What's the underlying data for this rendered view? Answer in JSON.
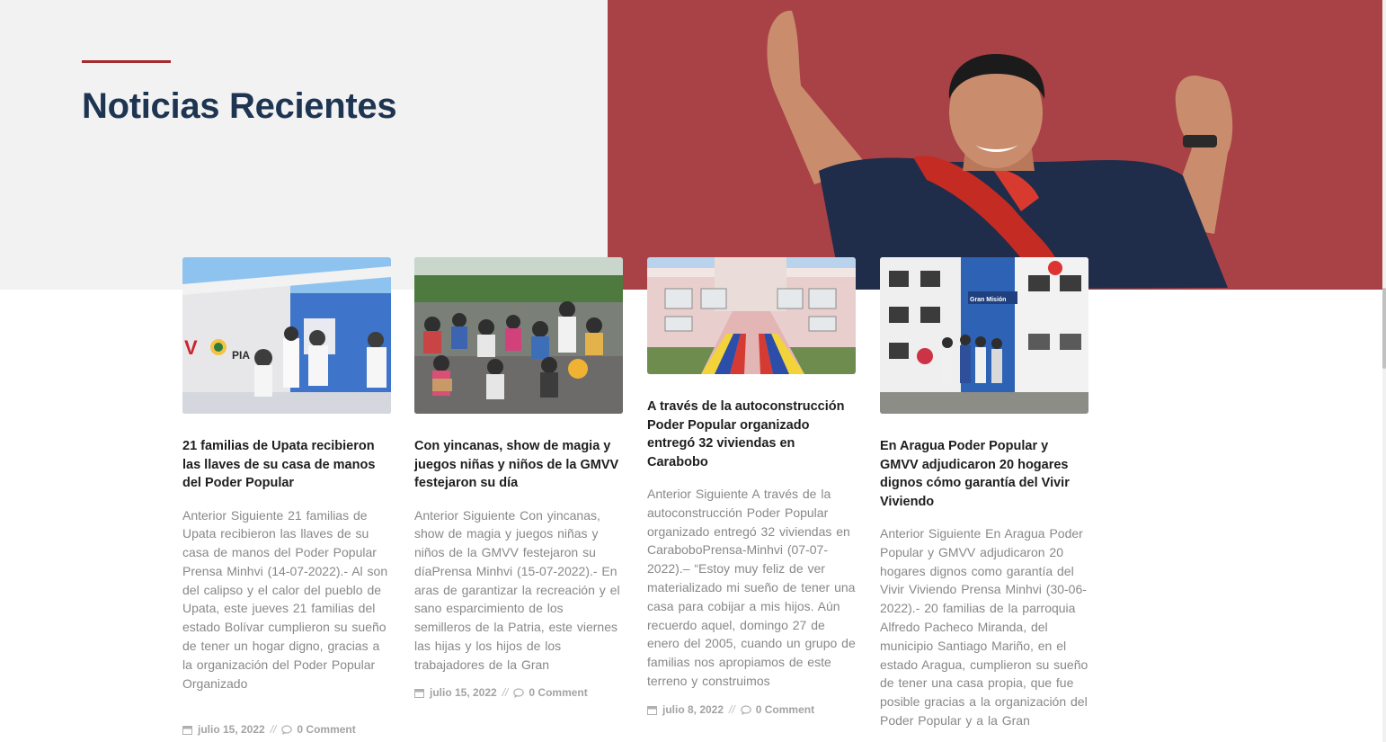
{
  "section": {
    "title": "Noticias Recientes"
  },
  "posts": [
    {
      "title": "21 familias de Upata recibieron las llaves de su casa de manos del Poder Popular",
      "excerpt": "Anterior Siguiente 21 familias de Upata recibieron las llaves de su casa de manos del Poder Popular Prensa Minhvi (14-07-2022).- Al son del calipso y el calor del pueblo de Upata, este jueves 21 familias del estado Bolívar cumplieron su sueño de tener un hogar digno, gracias a la organización del Poder Popular Organizado",
      "date": "julio 15, 2022",
      "comments": "0 Comment",
      "thumb_text": "PIA"
    },
    {
      "title": "Con yincanas, show de magia y juegos niñas y niños de la GMVV festejaron su día",
      "excerpt": "Anterior Siguiente Con yincanas, show de magia y juegos niñas y niños de la GMVV festejaron su díaPrensa Minhvi (15-07-2022).- En aras de garantizar la recreación y el sano esparcimiento de los semilleros de la Patria, este viernes las hijas y los hijos de los trabajadores de la Gran",
      "date": "julio 15, 2022",
      "comments": "0 Comment",
      "thumb_text": ""
    },
    {
      "title": "A través de la autoconstrucción Poder Popular organizado entregó 32 viviendas en Carabobo",
      "excerpt": "Anterior Siguiente A través de la autoconstrucción Poder Popular organizado entregó 32 viviendas en CaraboboPrensa-Minhvi (07-07-2022).– “Estoy muy feliz de ver materializado mi sueño de tener una casa para cobijar a mis hijos. Aún recuerdo aquel, domingo 27 de enero del 2005, cuando un grupo de familias nos apropiamos de este terreno y construimos",
      "date": "julio 8, 2022",
      "comments": "0 Comment",
      "thumb_text": ""
    },
    {
      "title": "En Aragua Poder Popular y GMVV adjudicaron 20 hogares dignos cómo garantía del Vivir Viviendo",
      "excerpt": "Anterior Siguiente En Aragua Poder Popular y GMVV adjudicaron 20 hogares dignos como garantía del Vivir Viviendo Prensa Minhvi (30-06-2022).- 20 familias de la parroquia Alfredo Pacheco Miranda, del municipio Santiago Mariño, en el estado Aragua, cumplieron su sueño de tener una casa propia, que fue posible gracias a la organización del Poder Popular y a la Gran",
      "date": "",
      "comments": "",
      "thumb_text": "Gran Misión"
    }
  ],
  "icons": {
    "date": "calendar-icon",
    "comments": "comment-icon"
  },
  "colors": {
    "accent": "#a42b2e",
    "banner": "#a94246",
    "title": "#1e3552",
    "meta": "#a3a3a3"
  }
}
